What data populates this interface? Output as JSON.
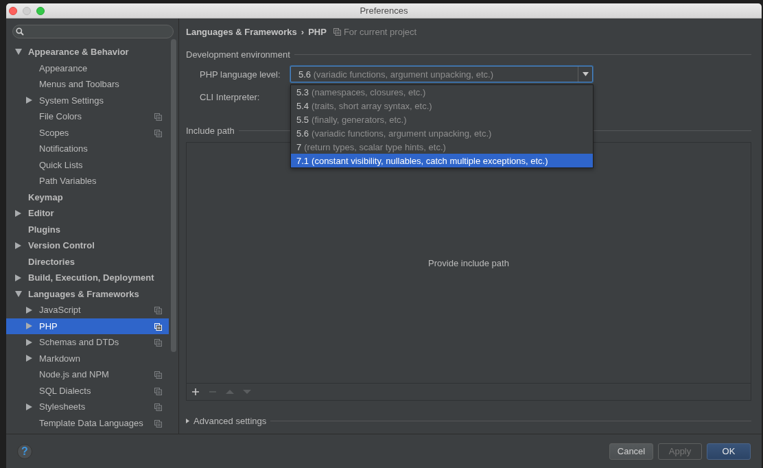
{
  "window": {
    "title": "Preferences"
  },
  "sidebar": {
    "items": [
      {
        "label": "Appearance & Behavior",
        "expanded": true,
        "selected": false,
        "project_level": false,
        "children": [
          {
            "label": "Appearance",
            "selected": false,
            "project_level": false
          },
          {
            "label": "Menus and Toolbars",
            "selected": false,
            "project_level": false
          },
          {
            "label": "System Settings",
            "expanded": false,
            "selected": false,
            "project_level": false
          },
          {
            "label": "File Colors",
            "selected": false,
            "project_level": true
          },
          {
            "label": "Scopes",
            "selected": false,
            "project_level": true
          },
          {
            "label": "Notifications",
            "selected": false,
            "project_level": false
          },
          {
            "label": "Quick Lists",
            "selected": false,
            "project_level": false
          },
          {
            "label": "Path Variables",
            "selected": false,
            "project_level": false
          }
        ]
      },
      {
        "label": "Keymap",
        "selected": false,
        "project_level": false
      },
      {
        "label": "Editor",
        "expanded": false,
        "selected": false,
        "project_level": false
      },
      {
        "label": "Plugins",
        "selected": false,
        "project_level": false
      },
      {
        "label": "Version Control",
        "expanded": false,
        "selected": false,
        "project_level": false
      },
      {
        "label": "Directories",
        "selected": false,
        "project_level": false
      },
      {
        "label": "Build, Execution, Deployment",
        "expanded": false,
        "selected": false,
        "project_level": false
      },
      {
        "label": "Languages & Frameworks",
        "expanded": true,
        "selected": false,
        "project_level": false,
        "children": [
          {
            "label": "JavaScript",
            "expanded": false,
            "selected": false,
            "project_level": true
          },
          {
            "label": "PHP",
            "expanded": false,
            "selected": true,
            "project_level": true
          },
          {
            "label": "Schemas and DTDs",
            "expanded": false,
            "selected": false,
            "project_level": true
          },
          {
            "label": "Markdown",
            "expanded": false,
            "selected": false,
            "project_level": false
          },
          {
            "label": "Node.js and NPM",
            "selected": false,
            "project_level": true
          },
          {
            "label": "SQL Dialects",
            "selected": false,
            "project_level": true
          },
          {
            "label": "Stylesheets",
            "expanded": false,
            "selected": false,
            "project_level": true
          },
          {
            "label": "Template Data Languages",
            "selected": false,
            "project_level": true
          }
        ]
      }
    ]
  },
  "breadcrumb": {
    "parent": "Languages & Frameworks",
    "separator": "›",
    "current": "PHP",
    "scope": "For current project"
  },
  "development_environment": {
    "title": "Development environment",
    "language_level": {
      "label": "PHP language level:",
      "version": "5.6",
      "description": "(variadic functions, argument unpacking, etc.)",
      "options": [
        {
          "version": "5.3",
          "description": "(namespaces, closures, etc.)",
          "selected": false
        },
        {
          "version": "5.4",
          "description": "(traits, short array syntax, etc.)",
          "selected": false
        },
        {
          "version": "5.5",
          "description": "(finally, generators, etc.)",
          "selected": false
        },
        {
          "version": "5.6",
          "description": "(variadic functions, argument unpacking, etc.)",
          "selected": false
        },
        {
          "version": "7",
          "description": "(return types, scalar type hints, etc.)",
          "selected": false
        },
        {
          "version": "7.1",
          "description": "(constant visibility, nullables, catch multiple exceptions, etc.)",
          "selected": true
        }
      ]
    },
    "cli_interpreter": {
      "label": "CLI Interpreter:"
    }
  },
  "include_path": {
    "title": "Include path",
    "empty_text": "Provide include path",
    "toolbar": [
      {
        "kind": "add",
        "disabled": false
      },
      {
        "kind": "remove",
        "disabled": true
      },
      {
        "kind": "up",
        "disabled": true
      },
      {
        "kind": "down",
        "disabled": true
      }
    ]
  },
  "advanced_settings": {
    "label": "Advanced settings",
    "expanded": false
  },
  "help_button": {
    "label": "?"
  },
  "buttons": [
    {
      "label": "Cancel",
      "kind": "normal",
      "disabled": false
    },
    {
      "label": "Apply",
      "kind": "normal",
      "disabled": true
    },
    {
      "label": "OK",
      "kind": "default",
      "disabled": false
    }
  ]
}
